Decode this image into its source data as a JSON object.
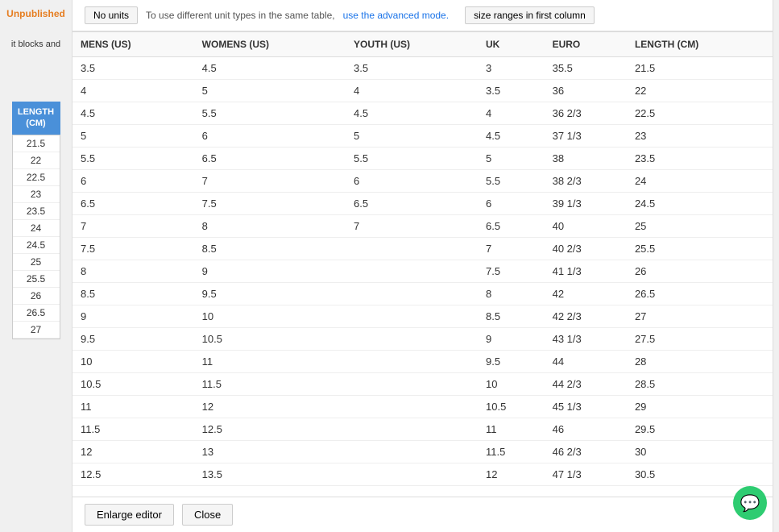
{
  "sidebar": {
    "unpublished_label": "Unpublished",
    "blocks_text": "it blocks and",
    "length_label": "LENGTH\n(CM)",
    "cm_values": [
      "21.5",
      "22",
      "22.5",
      "23",
      "23.5",
      "24",
      "24.5",
      "25",
      "25.5",
      "26",
      "26.5",
      "27"
    ]
  },
  "topbar": {
    "no_units_btn": "No units",
    "instruction_text": "To use different unit types in the same table,",
    "advanced_link_text": "use the advanced mode.",
    "size_ranges_btn": "size ranges in first column"
  },
  "table": {
    "headers": [
      "MENS (US)",
      "WOMENS (US)",
      "YOUTH (US)",
      "UK",
      "EURO",
      "LENGTH (CM)"
    ],
    "rows": [
      [
        "3.5",
        "4.5",
        "3.5",
        "3",
        "35.5",
        "21.5"
      ],
      [
        "4",
        "5",
        "4",
        "3.5",
        "36",
        "22"
      ],
      [
        "4.5",
        "5.5",
        "4.5",
        "4",
        "36 2/3",
        "22.5"
      ],
      [
        "5",
        "6",
        "5",
        "4.5",
        "37 1/3",
        "23"
      ],
      [
        "5.5",
        "6.5",
        "5.5",
        "5",
        "38",
        "23.5"
      ],
      [
        "6",
        "7",
        "6",
        "5.5",
        "38 2/3",
        "24"
      ],
      [
        "6.5",
        "7.5",
        "6.5",
        "6",
        "39 1/3",
        "24.5"
      ],
      [
        "7",
        "8",
        "7",
        "6.5",
        "40",
        "25"
      ],
      [
        "7.5",
        "8.5",
        "",
        "7",
        "40 2/3",
        "25.5"
      ],
      [
        "8",
        "9",
        "",
        "7.5",
        "41 1/3",
        "26"
      ],
      [
        "8.5",
        "9.5",
        "",
        "8",
        "42",
        "26.5"
      ],
      [
        "9",
        "10",
        "",
        "8.5",
        "42 2/3",
        "27"
      ],
      [
        "9.5",
        "10.5",
        "",
        "9",
        "43 1/3",
        "27.5"
      ],
      [
        "10",
        "11",
        "",
        "9.5",
        "44",
        "28"
      ],
      [
        "10.5",
        "11.5",
        "",
        "10",
        "44 2/3",
        "28.5"
      ],
      [
        "11",
        "12",
        "",
        "10.5",
        "45 1/3",
        "29"
      ],
      [
        "11.5",
        "12.5",
        "",
        "11",
        "46",
        "29.5"
      ],
      [
        "12",
        "13",
        "",
        "11.5",
        "46 2/3",
        "30"
      ],
      [
        "12.5",
        "13.5",
        "",
        "12",
        "47 1/3",
        "30.5"
      ]
    ]
  },
  "bottom": {
    "enlarge_label": "Enlarge editor",
    "close_label": "Close"
  },
  "chat": {
    "icon": "💬"
  }
}
